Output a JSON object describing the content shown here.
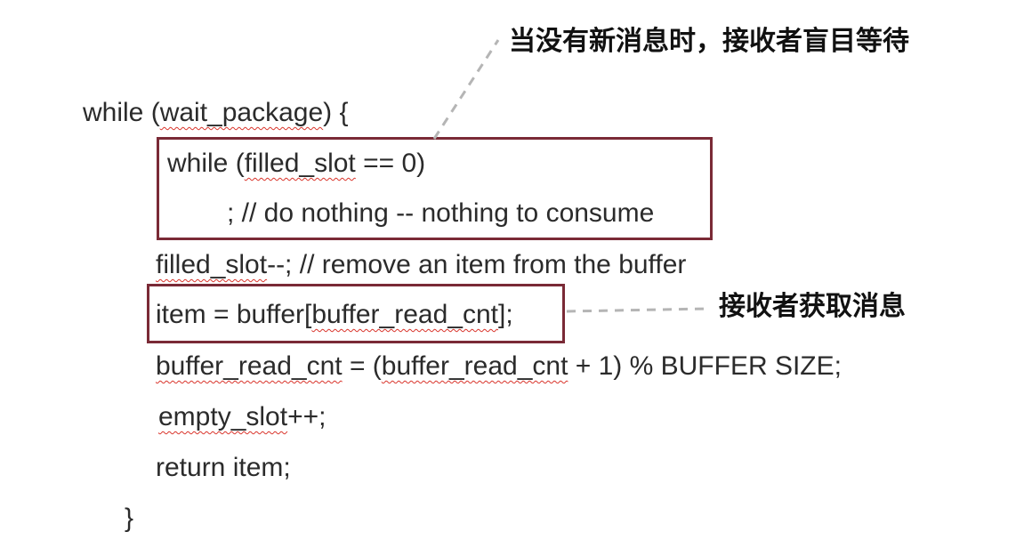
{
  "code": {
    "line1": {
      "a": "while (",
      "b": "wait_package",
      "c": ") {"
    },
    "line2": {
      "a": "while (",
      "b": "filled_slot",
      "c": " == 0)"
    },
    "line3": "; // do nothing -- nothing to consume",
    "line4": {
      "a": "filled_slot",
      "b": "--; // remove an item from the buffer"
    },
    "line5": {
      "a": "item = buffer[",
      "b": "buffer_read_cnt",
      "c": "];"
    },
    "line6": {
      "a": "buffer_read_cnt",
      "b": " = (",
      "c": "buffer_read_cnt",
      "d": " + 1) % BUFFER SIZE;"
    },
    "line7": {
      "a": "empty_slot",
      "b": "++;"
    },
    "line8": "return item;",
    "line9": "}"
  },
  "annotations": {
    "wait": "当没有新消息时，接收者盲目等待",
    "get": "接收者获取消息"
  },
  "colors": {
    "box_border": "#7a2a36",
    "squiggle": "#d9342b",
    "leader": "#b5b5b5"
  }
}
